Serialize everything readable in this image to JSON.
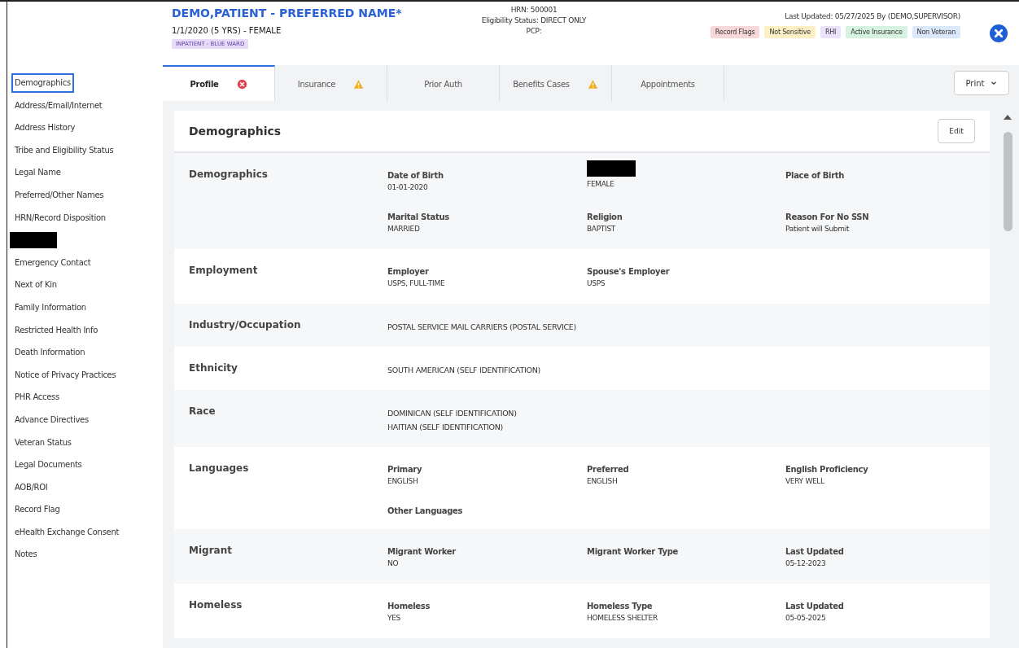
{
  "patient": {
    "name": "DEMO,PATIENT - PREFERRED NAME*",
    "summary": "1/1/2020 (5 YRS) - FEMALE",
    "location": "INPATIENT - BLUE WARD",
    "hrn": "HRN: 500001",
    "eligibility": "Eligibility Status: DIRECT ONLY",
    "pcp": "PCP:",
    "last_updated": "Last Updated: 05/27/2025 By (DEMO,SUPERVISOR)",
    "flags": [
      {
        "label": "Record Flags",
        "color": "#f8d7da"
      },
      {
        "label": "Not Sensitive",
        "color": "#fdf0c4"
      },
      {
        "label": "RHI",
        "color": "#ebe3fb"
      },
      {
        "label": "Active Insurance",
        "color": "#d6f2e0"
      },
      {
        "label": "Non Veteran",
        "color": "#dbe8fb"
      }
    ]
  },
  "sidebar": {
    "items": [
      {
        "label": "Demographics",
        "selected": true
      },
      {
        "label": "Address/Email/Internet",
        "selected": false
      },
      {
        "label": "Address History",
        "selected": false
      },
      {
        "label": "Tribe and Eligibility Status",
        "selected": false
      },
      {
        "label": "Legal Name",
        "selected": false
      },
      {
        "label": "Preferred/Other Names",
        "selected": false
      },
      {
        "label": "HRN/Record Disposition",
        "selected": false
      },
      {
        "redacted": true,
        "selected": false
      },
      {
        "label": "Emergency Contact",
        "selected": false
      },
      {
        "label": "Next of Kin",
        "selected": false
      },
      {
        "label": "Family Information",
        "selected": false
      },
      {
        "label": "Restricted Health Info",
        "selected": false
      },
      {
        "label": "Death Information",
        "selected": false
      },
      {
        "label": "Notice of Privacy Practices",
        "selected": false
      },
      {
        "label": "PHR Access",
        "selected": false
      },
      {
        "label": "Advance Directives",
        "selected": false
      },
      {
        "label": "Veteran Status",
        "selected": false
      },
      {
        "label": "Legal Documents",
        "selected": false
      },
      {
        "label": "AOB/ROI",
        "selected": false
      },
      {
        "label": "Record Flag",
        "selected": false
      },
      {
        "label": "eHealth Exchange Consent",
        "selected": false
      },
      {
        "label": "Notes",
        "selected": false
      }
    ]
  },
  "tabs": [
    {
      "label": "Profile",
      "selected": true,
      "error": true,
      "warning": false
    },
    {
      "label": "Insurance",
      "selected": false,
      "error": false,
      "warning": true
    },
    {
      "label": "Prior Auth",
      "selected": false,
      "error": false,
      "warning": false
    },
    {
      "label": "Benefits Cases",
      "selected": false,
      "error": false,
      "warning": true
    },
    {
      "label": "Appointments",
      "selected": false,
      "error": false,
      "warning": false
    }
  ],
  "print_button": "Print",
  "card": {
    "title": "Demographics",
    "edit_button": "Edit",
    "sections": [
      {
        "title": "Demographics",
        "fields": [
          {
            "kind": "field",
            "label": "Date of Birth",
            "value": "01-01-2020"
          },
          {
            "kind": "field",
            "label_redacted": true,
            "value": "FEMALE"
          },
          {
            "kind": "field",
            "label": "Place of Birth"
          },
          {
            "kind": "field",
            "label": "Marital Status",
            "value": "MARRIED"
          },
          {
            "kind": "field",
            "label": "Religion",
            "value": "BAPTIST"
          },
          {
            "kind": "field",
            "label": "Reason For No SSN",
            "value": "Patient will Submit"
          }
        ]
      },
      {
        "title": "Employment",
        "fields": [
          {
            "kind": "field",
            "label": "Employer",
            "value": "USPS, FULL-TIME"
          },
          {
            "kind": "field",
            "label": "Spouse's Employer",
            "value": "USPS"
          }
        ]
      },
      {
        "title": "Industry/Occupation",
        "fields": [
          {
            "kind": "text",
            "lines": [
              "POSTAL SERVICE MAIL CARRIERS (POSTAL SERVICE)"
            ]
          }
        ]
      },
      {
        "title": "Ethnicity",
        "fields": [
          {
            "kind": "text",
            "lines": [
              "SOUTH AMERICAN (SELF IDENTIFICATION)"
            ]
          }
        ]
      },
      {
        "title": "Race",
        "fields": [
          {
            "kind": "text",
            "lines": [
              "DOMINICAN (SELF IDENTIFICATION)",
              "HAITIAN (SELF IDENTIFICATION)"
            ]
          }
        ]
      },
      {
        "title": "Languages",
        "fields": [
          {
            "kind": "field",
            "label": "Primary",
            "value": "ENGLISH"
          },
          {
            "kind": "field",
            "label": "Preferred",
            "value": "ENGLISH"
          },
          {
            "kind": "field",
            "label": "English Proficiency",
            "value": "VERY WELL"
          },
          {
            "kind": "field",
            "label": "Other Languages"
          }
        ]
      },
      {
        "title": "Migrant",
        "fields": [
          {
            "kind": "field",
            "label": "Migrant Worker",
            "value": "NO"
          },
          {
            "kind": "field",
            "label": "Migrant Worker Type"
          },
          {
            "kind": "field",
            "label": "Last Updated",
            "value": "05-12-2023"
          }
        ]
      },
      {
        "title": "Homeless",
        "fields": [
          {
            "kind": "field",
            "label": "Homeless",
            "value": "YES"
          },
          {
            "kind": "field",
            "label": "Homeless Type",
            "value": "HOMELESS SHELTER"
          },
          {
            "kind": "field",
            "label": "Last Updated",
            "value": "05-05-2025"
          }
        ]
      }
    ]
  }
}
